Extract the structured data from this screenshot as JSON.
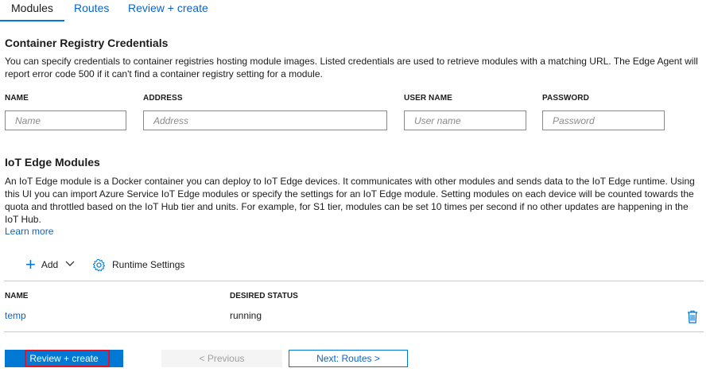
{
  "tabs": [
    {
      "label": "Modules"
    },
    {
      "label": "Routes"
    },
    {
      "label": "Review + create"
    }
  ],
  "registry": {
    "title": "Container Registry Credentials",
    "description": "You can specify credentials to container registries hosting module images. Listed credentials are used to retrieve modules with a matching URL. The Edge Agent will report error code 500 if it can't find a container registry setting for a module.",
    "columns": {
      "name": "NAME",
      "address": "ADDRESS",
      "username": "USER NAME",
      "password": "PASSWORD"
    },
    "placeholders": {
      "name": "Name",
      "address": "Address",
      "username": "User name",
      "password": "Password"
    }
  },
  "modules": {
    "title": "IoT Edge Modules",
    "description": "An IoT Edge module is a Docker container you can deploy to IoT Edge devices. It communicates with other modules and sends data to the IoT Edge runtime. Using this UI you can import Azure Service IoT Edge modules or specify the settings for an IoT Edge module. Setting modules on each device will be counted towards the quota and throttled based on the IoT Hub tier and units. For example, for S1 tier, modules can be set 10 times per second if no other updates are happening in the IoT Hub.",
    "learn_more": "Learn more",
    "toolbar": {
      "add_label": "Add",
      "runtime_label": "Runtime Settings"
    },
    "table": {
      "headers": {
        "name": "NAME",
        "status": "DESIRED STATUS"
      },
      "rows": [
        {
          "name": "temp",
          "status": "running"
        }
      ]
    }
  },
  "footer": {
    "review_create": "Review + create",
    "previous": "< Previous",
    "next": "Next: Routes >"
  },
  "colors": {
    "accent": "#0078d4",
    "link": "#0a64c8",
    "focus_ring": "#e81123"
  }
}
